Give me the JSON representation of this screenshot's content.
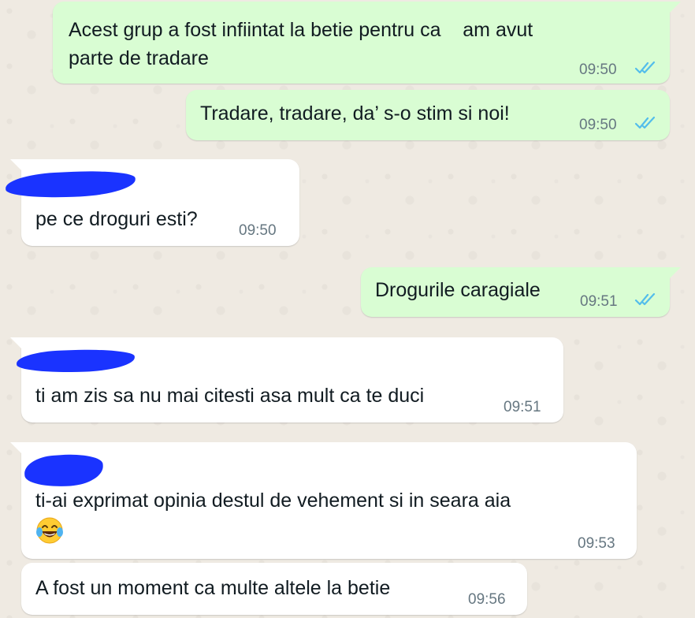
{
  "messages": [
    {
      "text_line1": "Acest grup a fost infiintat la betie pentru ca    am avut",
      "text_line2": "parte de tradare",
      "time": "09:50",
      "direction": "outgoing",
      "status": "read"
    },
    {
      "text": "Tradare, tradare, da’ s-o stim si noi!",
      "time": "09:50",
      "direction": "outgoing",
      "status": "read"
    },
    {
      "text": "pe ce droguri esti?",
      "time": "09:50",
      "direction": "incoming",
      "sender_redacted": true
    },
    {
      "text": "Drogurile caragiale",
      "time": "09:51",
      "direction": "outgoing",
      "status": "read"
    },
    {
      "text": "ti am zis sa nu mai citesti asa mult ca te duci",
      "time": "09:51",
      "direction": "incoming",
      "sender_redacted": true
    },
    {
      "text": "ti-ai exprimat opinia destul de vehement si in seara aia",
      "emoji": "face-with-tears-of-joy",
      "time": "09:53",
      "direction": "incoming",
      "sender_redacted": true
    },
    {
      "text": "A fost un moment ca multe altele la betie",
      "time": "09:56",
      "direction": "incoming"
    }
  ],
  "colors": {
    "outgoing_bubble": "#d9fdd3",
    "incoming_bubble": "#ffffff",
    "read_ticks": "#53bdeb",
    "timestamp": "#667781",
    "redaction": "#1a33ff",
    "chat_background": "#efeae2"
  }
}
